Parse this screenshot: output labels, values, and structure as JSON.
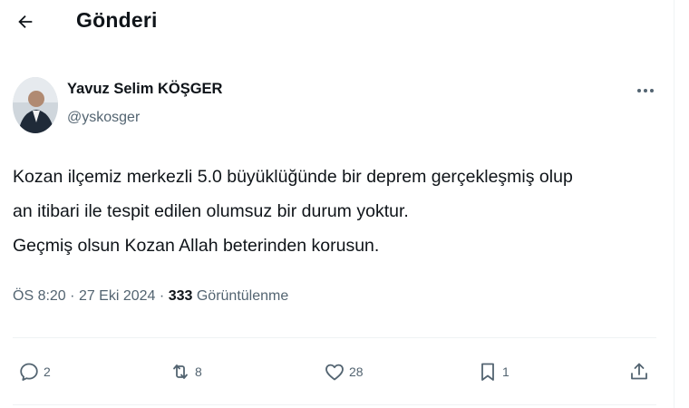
{
  "header": {
    "title": "Gönderi",
    "back_icon": "arrow-left-icon"
  },
  "author": {
    "name": "Yavuz Selim KÖŞGER",
    "handle": "@yskosger"
  },
  "tweet": {
    "lines": [
      "Kozan ilçemiz merkezli 5.0 büyüklüğünde bir deprem gerçekleşmiş olup",
      "an itibari ile tespit edilen olumsuz bir durum yoktur.",
      "Geçmiş olsun Kozan Allah beterinden korusun."
    ],
    "time": "ÖS 8:20",
    "sep": "·",
    "date": "27 Eki 2024",
    "views": "333",
    "views_label": "Görüntülenme"
  },
  "actions": {
    "reply": {
      "icon": "reply-icon",
      "count": "2"
    },
    "retweet": {
      "icon": "retweet-icon",
      "count": "8"
    },
    "like": {
      "icon": "heart-icon",
      "count": "28"
    },
    "bookmark": {
      "icon": "bookmark-icon",
      "count": "1"
    },
    "share": {
      "icon": "share-icon"
    }
  },
  "colors": {
    "text": "#0f1419",
    "secondary": "#536471",
    "divider": "#eff3f4"
  }
}
